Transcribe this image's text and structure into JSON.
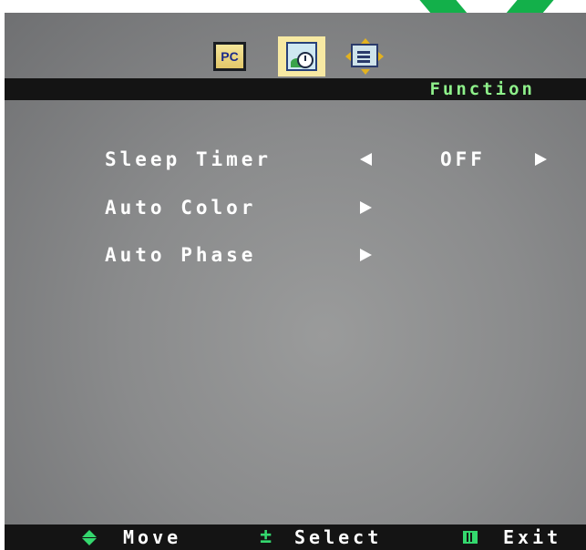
{
  "osd": {
    "tabs": [
      {
        "label": "PC",
        "icon": "pc-icon",
        "selected": false
      },
      {
        "label": "",
        "icon": "function-clock-icon",
        "selected": true
      },
      {
        "label": "",
        "icon": "osd-settings-icon",
        "selected": false
      }
    ],
    "title": "Function",
    "items": [
      {
        "label": "Sleep Timer",
        "value": "OFF"
      },
      {
        "label": "Auto Color"
      },
      {
        "label": "Auto Phase"
      }
    ],
    "hints": {
      "move": "Move",
      "select": "Select",
      "select_symbol": "±",
      "exit": "Exit"
    }
  },
  "colors": {
    "title_text": "#8ef08a",
    "hint_icons": "#34d86e",
    "bar_background": "#141414"
  }
}
